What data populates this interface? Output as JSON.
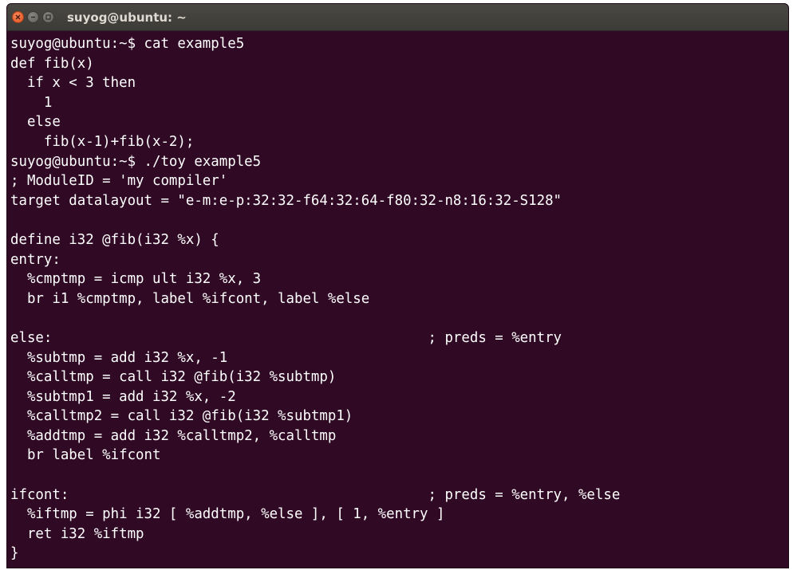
{
  "window": {
    "title": "suyog@ubuntu: ~",
    "buttons": [
      "close-icon",
      "minimize-icon",
      "maximize-icon"
    ]
  },
  "colors": {
    "terminal_bg": "#300a24",
    "terminal_fg": "#ffffff",
    "titlebar_bg": "#3c3b37",
    "close_button": "#e2531e"
  },
  "terminal": {
    "lines": [
      "suyog@ubuntu:~$ cat example5",
      "def fib(x)",
      "  if x < 3 then",
      "    1",
      "  else",
      "    fib(x-1)+fib(x-2);",
      "suyog@ubuntu:~$ ./toy example5",
      "; ModuleID = 'my compiler'",
      "target datalayout = \"e-m:e-p:32:32-f64:32:64-f80:32-n8:16:32-S128\"",
      "",
      "define i32 @fib(i32 %x) {",
      "entry:",
      "  %cmptmp = icmp ult i32 %x, 3",
      "  br i1 %cmptmp, label %ifcont, label %else",
      "",
      "else:                                             ; preds = %entry",
      "  %subtmp = add i32 %x, -1",
      "  %calltmp = call i32 @fib(i32 %subtmp)",
      "  %subtmp1 = add i32 %x, -2",
      "  %calltmp2 = call i32 @fib(i32 %subtmp1)",
      "  %addtmp = add i32 %calltmp2, %calltmp",
      "  br label %ifcont",
      "",
      "ifcont:                                           ; preds = %entry, %else",
      "  %iftmp = phi i32 [ %addtmp, %else ], [ 1, %entry ]",
      "  ret i32 %iftmp",
      "}"
    ]
  }
}
